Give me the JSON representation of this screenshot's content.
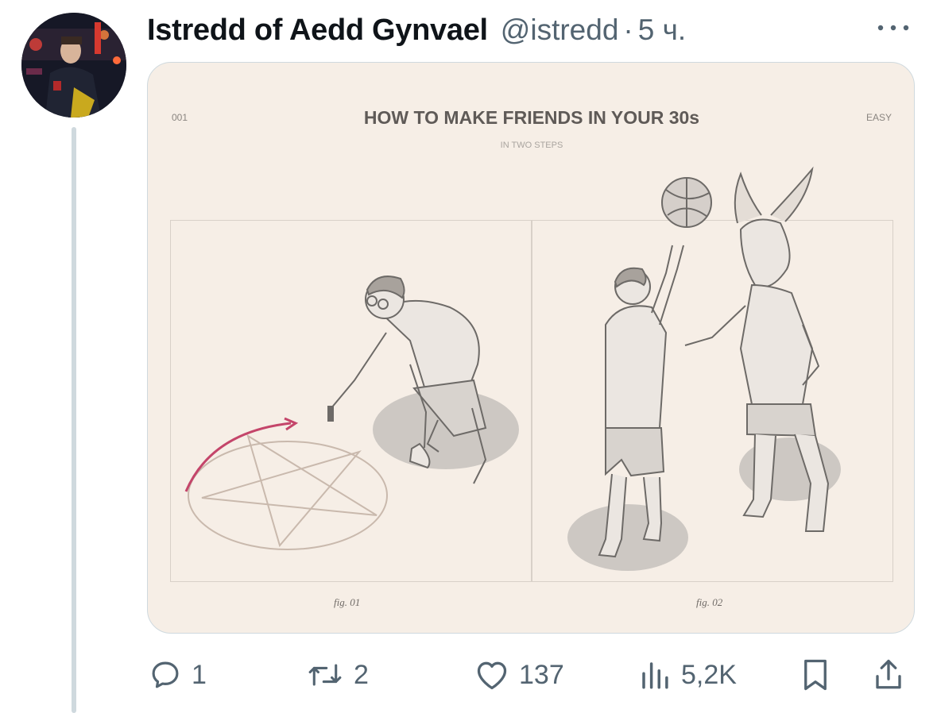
{
  "tweet": {
    "author_name": "Istredd of Aedd Gynvael",
    "handle": "@istredd",
    "separator": "·",
    "time": "5 ч."
  },
  "media": {
    "index": "001",
    "title": "HOW TO MAKE FRIENDS IN YOUR 30s",
    "subtitle": "IN TWO STEPS",
    "difficulty": "EASY",
    "fig1_caption": "fig. 01",
    "fig2_caption": "fig. 02"
  },
  "actions": {
    "replies": "1",
    "retweets": "2",
    "likes": "137",
    "views": "5,2K"
  },
  "colors": {
    "text_primary": "#0f1419",
    "text_secondary": "#536471",
    "border": "#cfd9de",
    "media_bg": "#f6eee6",
    "arrow_accent": "#c4456a"
  },
  "icons": [
    "more-icon",
    "reply-icon",
    "retweet-icon",
    "like-icon",
    "views-icon",
    "bookmark-icon",
    "share-icon"
  ]
}
